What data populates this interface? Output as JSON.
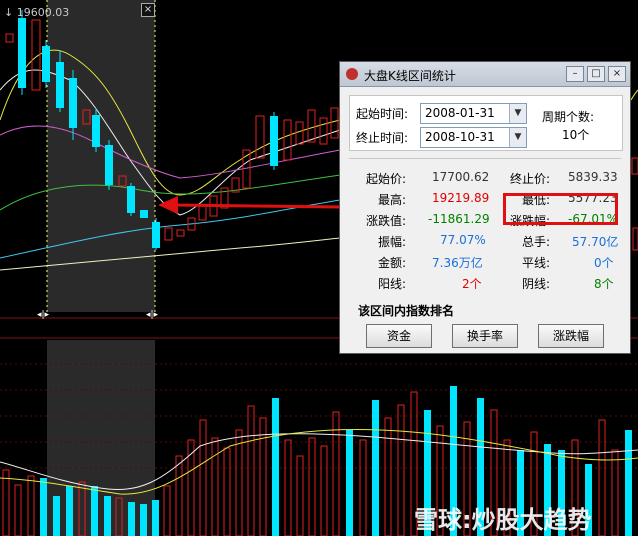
{
  "chart": {
    "top_value_label": "19600.03",
    "close_label": "×"
  },
  "dialog": {
    "title": "大盘K线区间统计",
    "window_buttons": [
      "–",
      "□",
      "×"
    ],
    "start_label": "起始时间:",
    "start_value": "2008-01-31",
    "end_label": "终止时间:",
    "end_value": "2008-10-31",
    "period_label": "周期个数:",
    "period_value": "10个",
    "stats": {
      "open_label": "起始价:",
      "open_value": "17700.62",
      "close_label": "终止价:",
      "close_value": "5839.33",
      "high_label": "最高:",
      "high_value": "19219.89",
      "low_label": "最低:",
      "low_value": "5577.23",
      "chg_label": "涨跌值:",
      "chg_value": "-11861.29",
      "chgpct_label": "涨跌幅:",
      "chgpct_value": "-67.01%",
      "amp_label": "振幅:",
      "amp_value": "77.07%",
      "vol_label": "总手:",
      "vol_value": "57.70亿",
      "amt_label": "金额:",
      "amt_value": "7.36万亿",
      "flat_label": "平线:",
      "flat_value": "0个",
      "up_label": "阳线:",
      "up_value": "2个",
      "down_label": "阴线:",
      "down_value": "8个"
    },
    "rank_title": "该区间内指数排名",
    "buttons": [
      "资金",
      "换手率",
      "涨跌幅"
    ]
  },
  "watermark": "雪球:炒股大趋势",
  "colors": {
    "up": "#e02020",
    "down": "#00e5ff",
    "highlight_box": "#e01010",
    "arrow": "#e01010"
  }
}
